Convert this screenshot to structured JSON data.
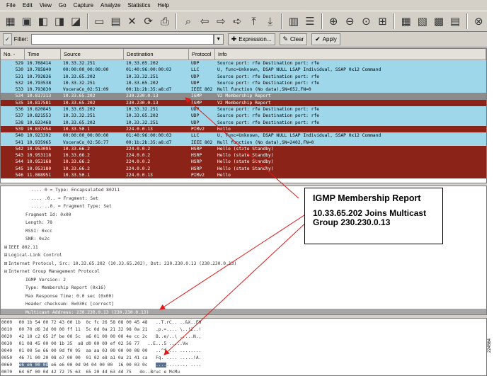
{
  "menu": [
    "File",
    "Edit",
    "View",
    "Go",
    "Capture",
    "Analyze",
    "Statistics",
    "Help"
  ],
  "toolbar": {
    "icons": [
      "interface-list-icon",
      "capture-options-icon",
      "capture-start-icon",
      "capture-stop-icon",
      "capture-restart-icon",
      "open-file-icon",
      "save-file-icon",
      "close-file-icon",
      "reload-icon",
      "print-icon",
      "find-packet-icon",
      "go-back-icon",
      "go-forward-icon",
      "go-to-packet-icon",
      "go-first-icon",
      "go-last-icon",
      "colorize-icon",
      "autoscroll-icon",
      "zoom-in-icon",
      "zoom-out-icon",
      "zoom-normal-icon",
      "resize-columns-icon",
      "capture-filters-icon",
      "display-filters-icon",
      "coloring-rules-icon",
      "preferences-icon",
      "help-icon"
    ]
  },
  "filter": {
    "label": "Filter:",
    "value": "",
    "expression_label": "Expression...",
    "clear_label": "Clear",
    "apply_label": "Apply"
  },
  "columns": [
    "No. -",
    "Time",
    "Source",
    "Destination",
    "Protocol",
    "Info"
  ],
  "colors": {
    "light_blue": "#9fd7ea",
    "dark_red": "#8b2318",
    "selected_gray": "#8c8c8c",
    "arrow_red": "#e01818"
  },
  "packets": [
    {
      "no": "529",
      "time": "10.768414",
      "src": "10.33.32.251",
      "dst": "10.33.65.202",
      "proto": "UDP",
      "info": "Source port: rfe  Destination port: rfe",
      "style": "blue"
    },
    {
      "no": "530",
      "time": "10.785840",
      "src": "00:00:00_00:00:00",
      "dst": "01:40:96:00:00:03",
      "proto": "LLC",
      "info": "U, func=Unknown, DSAP NULL LSAP Individual, SSAP 0x12 Command",
      "style": "blue"
    },
    {
      "no": "531",
      "time": "10.792836",
      "src": "10.33.65.202",
      "dst": "10.33.32.251",
      "proto": "UDP",
      "info": "Source port: rfe  Destination port: rfe",
      "style": "blue"
    },
    {
      "no": "532",
      "time": "10.793538",
      "src": "10.33.32.251",
      "dst": "10.33.65.202",
      "proto": "UDP",
      "info": "Source port: rfe  Destination port: rfe",
      "style": "blue"
    },
    {
      "no": "533",
      "time": "10.793830",
      "src": "VoceraCo_02:51:09",
      "dst": "00:1b:2b:35:a8:d7",
      "proto": "IEEE 802",
      "info": "Null function (No data),SN=652,FN=0",
      "style": "blue"
    },
    {
      "no": "534",
      "time": "10.817213",
      "src": "10.33.65.202",
      "dst": "230.230.0.13",
      "proto": "IGMP",
      "info": "V2 Membership Report",
      "style": "selected"
    },
    {
      "no": "535",
      "time": "10.817581",
      "src": "10.33.65.202",
      "dst": "230.230.0.13",
      "proto": "IGMP",
      "info": "V2 Membership Report",
      "style": "red"
    },
    {
      "no": "536",
      "time": "10.820845",
      "src": "10.33.65.202",
      "dst": "10.33.32.251",
      "proto": "UDP",
      "info": "Source port: rfe  Destination port: rfe",
      "style": "blue"
    },
    {
      "no": "537",
      "time": "10.821553",
      "src": "10.33.32.251",
      "dst": "10.33.65.202",
      "proto": "UDP",
      "info": "Source port: rfe  Destination port: rfe",
      "style": "blue"
    },
    {
      "no": "538",
      "time": "10.833468",
      "src": "10.33.65.202",
      "dst": "10.33.32.251",
      "proto": "UDP",
      "info": "Source port: rfe  Destination port: rfe",
      "style": "blue"
    },
    {
      "no": "539",
      "time": "10.837454",
      "src": "10.33.50.1",
      "dst": "224.0.0.13",
      "proto": "PIMv2",
      "info": "Hello",
      "style": "red"
    },
    {
      "no": "540",
      "time": "10.923392",
      "src": "00:00:00_00:00:00",
      "dst": "01:40:96:00:00:03",
      "proto": "LLC",
      "info": "U, func=Unknown, DSAP NULL LSAP Individual, SSAP 0x12 Command",
      "style": "blue"
    },
    {
      "no": "541",
      "time": "10.935965",
      "src": "VoceraCo_02:56:77",
      "dst": "00:1b:2b:35:a8:d7",
      "proto": "IEEE 802",
      "info": "Null function (No data),SN=2402,FN=0",
      "style": "blue"
    },
    {
      "no": "542",
      "time": "10.953095",
      "src": "10.33.66.2",
      "dst": "224.0.0.2",
      "proto": "HSRP",
      "info": "Hello (state Standby)",
      "style": "red"
    },
    {
      "no": "543",
      "time": "10.953118",
      "src": "10.33.66.2",
      "dst": "224.0.0.2",
      "proto": "HSRP",
      "info": "Hello (state Standby)",
      "style": "red"
    },
    {
      "no": "544",
      "time": "10.953168",
      "src": "10.33.66.2",
      "dst": "224.0.0.2",
      "proto": "HSRP",
      "info": "Hello (state Standby)",
      "style": "red"
    },
    {
      "no": "545",
      "time": "10.953180",
      "src": "10.33.66.2",
      "dst": "224.0.0.2",
      "proto": "HSRP",
      "info": "Hello (state Standby)",
      "style": "red"
    },
    {
      "no": "546",
      "time": "11.088951",
      "src": "10.33.50.1",
      "dst": "224.0.0.13",
      "proto": "PIMv2",
      "info": "Hello",
      "style": "red"
    }
  ],
  "details": [
    {
      "indent": 4,
      "exp": "",
      "text": ".... 0 = Type: Encapsulated 80211"
    },
    {
      "indent": 4,
      "exp": "",
      "text": ".... .0.. = Fragment: Set"
    },
    {
      "indent": 4,
      "exp": "",
      "text": ".... ..0. = Fragment Type: Set"
    },
    {
      "indent": 3,
      "exp": "",
      "text": "Fragment Id: 0x00"
    },
    {
      "indent": 3,
      "exp": "",
      "text": "Length: 78"
    },
    {
      "indent": 3,
      "exp": "",
      "text": "RSSI: 0xcc"
    },
    {
      "indent": 3,
      "exp": "",
      "text": "SNR: 0x2c"
    },
    {
      "indent": 0,
      "exp": "+",
      "text": "IEEE 802.11"
    },
    {
      "indent": 0,
      "exp": "+",
      "text": "Logical-Link Control"
    },
    {
      "indent": 0,
      "exp": "+",
      "text": "Internet Protocol, Src: 10.33.65.202 (10.33.65.202), Dst: 230.230.0.13 (230.230.0.13)"
    },
    {
      "indent": 0,
      "exp": "-",
      "text": "Internet Group Management Protocol"
    },
    {
      "indent": 3,
      "exp": "",
      "text": "IGMP Version: 2"
    },
    {
      "indent": 3,
      "exp": "",
      "text": "Type: Membership Report (0x16)"
    },
    {
      "indent": 3,
      "exp": "",
      "text": "Max Response Time: 0.0 sec (0x00)"
    },
    {
      "indent": 3,
      "exp": "",
      "text": "Header checksum: 0x030c [correct]"
    },
    {
      "indent": 3,
      "exp": "",
      "text": "Multicast Address: 230.230.0.13 (230.230.0.13)",
      "selected": true
    }
  ],
  "hex": [
    {
      "offset": "0000",
      "bytes": "00 1b 54 00 72 43 00 1b  0c fc 26 58 08 00 45 48",
      "ascii": "..T.rC.. ..&X..EH"
    },
    {
      "offset": "0010",
      "bytes": "00 70 d6 3d 00 00 ff 11  5c 0d 0a 21 32 98 0a 21",
      "ascii": ".p.=.... \\..!2..!"
    },
    {
      "offset": "0020",
      "bytes": "42 10 c2 65 2f be 00 5c  a6 01 00 00 00 4e cc 2c",
      "ascii": "B..e/..\\ .....N.,"
    },
    {
      "offset": "0030",
      "bytes": "01 08 45 00 00 1b 35  a8 d0 00 09 ef 02 56 77",
      "ascii": "..E...5 .....Vw"
    },
    {
      "offset": "0040",
      "bytes": "01 00 5e 66 00 0d f0 95  aa aa 03 00 00 00 08 00",
      "ascii": "..^f.... ........"
    },
    {
      "offset": "0050",
      "bytes": "46 71 00 20 08 e7 00 00  01 02 e8 a1 0a 21 41 ca",
      "ascii": "Fq. .... .....!A."
    },
    {
      "offset": "0060",
      "bytes": "e6 e6 00 0d 94 04 00 00  16 00 03 0c",
      "hl": "e6 e6 00 0d",
      "ascii": "........ ....",
      "ascii_hl": "...."
    },
    {
      "offset": "0070",
      "bytes": "64 6f 00 0d 42 72 75 63  65 20 4d 63 4d 75",
      "ascii": "do..Bruc e McMu"
    }
  ],
  "callout": {
    "title": "IGMP Membership Report",
    "body_line1": "10.33.65.202 Joins Multicast",
    "body_line2": "Group 230.230.0.13"
  },
  "figure_id": "224564"
}
